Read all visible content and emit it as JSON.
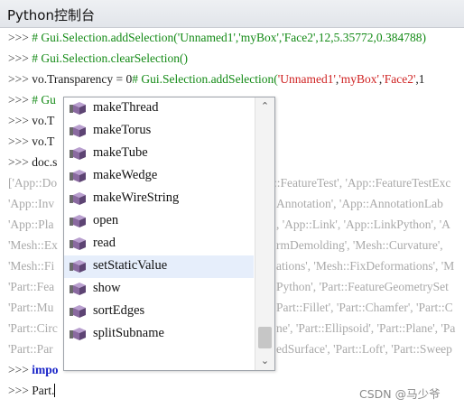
{
  "window": {
    "title": "Python控制台"
  },
  "console": {
    "prompt": ">>>",
    "line1": {
      "comment": "# Gui.Selection.addSelection('Unnamed1','myBox','Face2',12,5.35772,0.384788)"
    },
    "line2": {
      "comment": "# Gui.Selection.clearSelection()"
    },
    "line3": {
      "code": "vo.Transparency = 0",
      "comment": "# Gui.Selection.addSelection(",
      "str1": "'Unnamed1'",
      "sep": ",",
      "str2": "'myBox'",
      "str3": "'Face2'",
      "tail": ",1"
    },
    "line4": {
      "comment": "# Gu"
    },
    "line5": {
      "code": "vo.T"
    },
    "line6": {
      "code": "vo.T"
    },
    "line7": {
      "code": "doc.s"
    },
    "output": [
      {
        "left": "['App::Do",
        "right": "::FeatureTest', 'App::FeatureTestExc"
      },
      {
        "left": "'App::Inv",
        "right": "Annotation', 'App::AnnotationLab"
      },
      {
        "left": "'App::Pla",
        "right": ", 'App::Link', 'App::LinkPython', 'A"
      },
      {
        "left": "'Mesh::Ex",
        "right": "rmDemolding', 'Mesh::Curvature',"
      },
      {
        "left": "'Mesh::Fi",
        "right": "ations', 'Mesh::FixDeformations', 'M"
      },
      {
        "left": "'Part::Fea",
        "right": "Python', 'Part::FeatureGeometrySet"
      },
      {
        "left": "'Part::Mu",
        "right": "Part::Fillet', 'Part::Chamfer', 'Part::C"
      },
      {
        "left": "'Part::Circ",
        "right": "ne', 'Part::Ellipsoid', 'Part::Plane', 'Pa"
      },
      {
        "left": "'Part::Par",
        "right": "edSurface', 'Part::Loft', 'Part::Sweep"
      }
    ],
    "line_import": {
      "keyword": "impo"
    },
    "current_input": "Part."
  },
  "autocomplete": {
    "items": [
      {
        "label": "makeThread"
      },
      {
        "label": "makeTorus"
      },
      {
        "label": "makeTube"
      },
      {
        "label": "makeWedge"
      },
      {
        "label": "makeWireString"
      },
      {
        "label": "open"
      },
      {
        "label": "read"
      },
      {
        "label": "setStaticValue"
      },
      {
        "label": "show"
      },
      {
        "label": "sortEdges"
      },
      {
        "label": "splitSubname"
      }
    ],
    "selected_label": "setStaticValue",
    "scroll_up_glyph": "⌃",
    "scroll_down_glyph": "⌄",
    "item_icon": "python-method-cube-icon"
  },
  "watermark": "CSDN @马少爷",
  "colors": {
    "comment": "#138a15",
    "string": "#cf2222",
    "keyword": "#1a25c8",
    "output": "#a9a9a9",
    "selection": "#e6eefb",
    "icon": "#8a6aa0"
  }
}
